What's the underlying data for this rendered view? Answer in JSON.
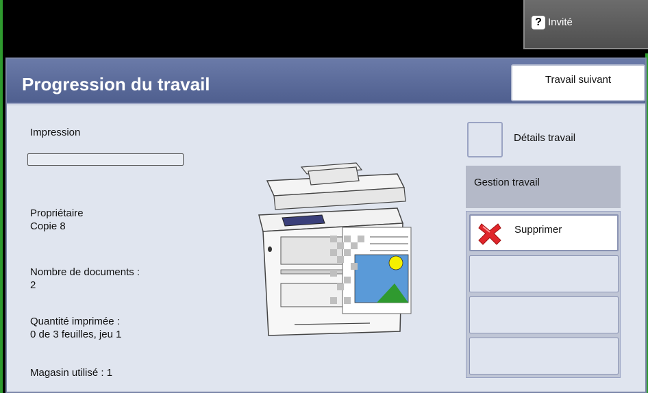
{
  "topbar": {
    "guest_label": "Invité"
  },
  "header": {
    "title": "Progression du travail",
    "next_job_label": "Travail suivant"
  },
  "status": {
    "printing_label": "Impression",
    "progress_fraction": 0.0,
    "owner_label": "Propriétaire",
    "owner_value": "Copie 8",
    "doc_count_label": "Nombre de documents :",
    "doc_count_value": "2",
    "printed_qty_label": "Quantité imprimée :",
    "printed_qty_value": "0 de 3 feuilles, jeu 1",
    "tray_used": "Magasin utilisé : 1"
  },
  "side": {
    "job_details_label": "Détails travail",
    "job_management_label": "Gestion travail",
    "delete_label": "Supprimer"
  },
  "colors": {
    "header_bg": "#5a6a9a",
    "panel_bg": "#e0e5ef",
    "frame_green": "#2f9a2f",
    "delete_red": "#e0262b"
  }
}
